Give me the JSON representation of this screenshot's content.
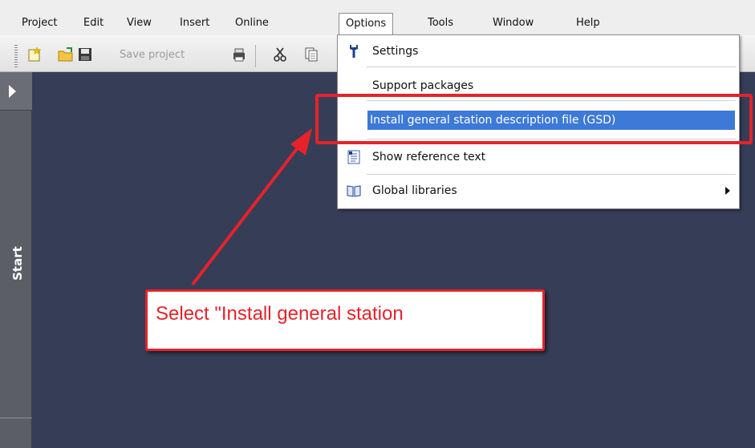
{
  "menubar": {
    "items": [
      {
        "label": "Project"
      },
      {
        "label": "Edit"
      },
      {
        "label": "View"
      },
      {
        "label": "Insert"
      },
      {
        "label": "Online"
      },
      {
        "label": "Options"
      },
      {
        "label": "Tools"
      },
      {
        "label": "Window"
      },
      {
        "label": "Help"
      }
    ],
    "active": "Options"
  },
  "toolbar": {
    "save_label": "Save project",
    "icons": [
      "new-project-icon",
      "open-project-icon",
      "save-icon",
      "print-icon",
      "cut-icon",
      "copy-icon"
    ]
  },
  "left_rail": {
    "label": "Start",
    "expand_icon": "chevron-right-icon"
  },
  "options_menu": {
    "items": [
      {
        "label": "Settings",
        "icon": "wrench-icon"
      },
      {
        "label": "Support packages"
      },
      {
        "label": "Install general station description file (GSD)",
        "selected": true
      },
      {
        "label": "Show reference text",
        "icon": "reference-text-icon"
      },
      {
        "label": "Global libraries",
        "icon": "book-icon",
        "has_submenu": true
      }
    ]
  },
  "annotation": {
    "callout_text": "Select \"Install general station",
    "color": "#e4232b"
  },
  "colors": {
    "main_background": "#363d56",
    "rail": "#5b5e67",
    "selection": "#3d79d6"
  }
}
